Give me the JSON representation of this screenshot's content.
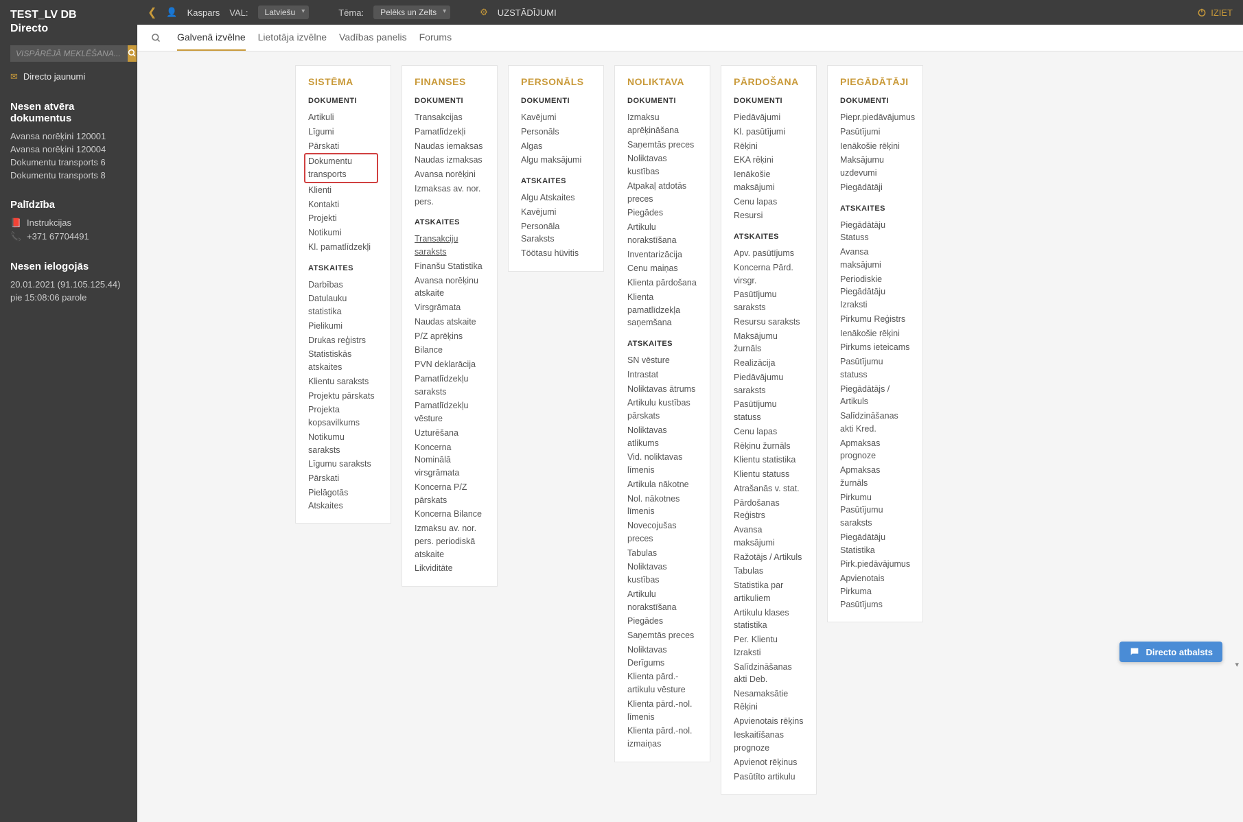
{
  "sidebar": {
    "title1": "TEST_LV DB",
    "title2": "Directo",
    "search_placeholder": "VISPĀRĒJĀ MEKLĒŠANA...",
    "news": "Directo jaunumi",
    "recent_docs_title": "Nesen atvēra dokumentus",
    "recent_docs": [
      "Avansa norēķini 120001",
      "Avansa norēķini 120004",
      "Dokumentu transports 6",
      "Dokumentu transports 8"
    ],
    "help_title": "Palīdzība",
    "help_instructions": "Instrukcijas",
    "help_phone": "+371 67704491",
    "login_title": "Nesen ielogojās",
    "login_line1": "20.01.2021 (91.105.125.44)",
    "login_line2": "pie 15:08:06 parole"
  },
  "topbar": {
    "user": "Kaspars",
    "lang_label": "VAL:",
    "lang_value": "Latviešu",
    "theme_label": "Tēma:",
    "theme_value": "Pelēks un Zelts",
    "settings": "UZSTĀDĪJUMI",
    "logout": "IZIET"
  },
  "tabs": [
    "Galvenā izvēlne",
    "Lietotāja izvēlne",
    "Vadības panelis",
    "Forums"
  ],
  "columns": [
    {
      "title": "SISTĒMA",
      "sections": [
        {
          "label": "DOKUMENTI",
          "items": [
            {
              "t": "Artikuli"
            },
            {
              "t": "Līgumi"
            },
            {
              "t": "Pārskati"
            },
            {
              "t": "Dokumentu transports",
              "hl": true
            },
            {
              "t": "Klienti"
            },
            {
              "t": "Kontakti"
            },
            {
              "t": "Projekti"
            },
            {
              "t": "Notikumi"
            },
            {
              "t": "Kl. pamatlīdzekļi"
            }
          ]
        },
        {
          "label": "ATSKAITES",
          "items": [
            {
              "t": "Darbības"
            },
            {
              "t": "Datulauku statistika"
            },
            {
              "t": "Pielikumi"
            },
            {
              "t": "Drukas reģistrs"
            },
            {
              "t": "Statistiskās atskaites"
            },
            {
              "t": "Klientu saraksts"
            },
            {
              "t": "Projektu pārskats"
            },
            {
              "t": "Projekta kopsavilkums"
            },
            {
              "t": "Notikumu saraksts"
            },
            {
              "t": "Līgumu saraksts"
            },
            {
              "t": "Pārskati"
            },
            {
              "t": "Pielāgotās Atskaites"
            }
          ]
        }
      ]
    },
    {
      "title": "FINANSES",
      "sections": [
        {
          "label": "DOKUMENTI",
          "items": [
            {
              "t": "Transakcijas"
            },
            {
              "t": "Pamatlīdzekļi"
            },
            {
              "t": "Naudas iemaksas"
            },
            {
              "t": "Naudas izmaksas"
            },
            {
              "t": "Avansa norēķini"
            },
            {
              "t": "Izmaksas av. nor. pers."
            }
          ]
        },
        {
          "label": "ATSKAITES",
          "items": [
            {
              "t": "Transakciju saraksts",
              "und": true
            },
            {
              "t": "Finanšu Statistika"
            },
            {
              "t": "Avansa norēķinu atskaite"
            },
            {
              "t": "Virsgrāmata"
            },
            {
              "t": "Naudas atskaite"
            },
            {
              "t": "P/Z aprēķins"
            },
            {
              "t": "Bilance"
            },
            {
              "t": "PVN deklarācija"
            },
            {
              "t": "Pamatlīdzekļu saraksts"
            },
            {
              "t": "Pamatlīdzekļu vēsture"
            },
            {
              "t": "Uzturēšana"
            },
            {
              "t": "Koncerna Nominālā virsgrāmata"
            },
            {
              "t": "Koncerna P/Z pārskats"
            },
            {
              "t": "Koncerna Bilance"
            },
            {
              "t": "Izmaksu av. nor. pers. periodiskā atskaite"
            },
            {
              "t": "Likviditāte"
            }
          ]
        }
      ]
    },
    {
      "title": "PERSONĀLS",
      "sections": [
        {
          "label": "DOKUMENTI",
          "items": [
            {
              "t": "Kavējumi"
            },
            {
              "t": "Personāls"
            },
            {
              "t": "Algas"
            },
            {
              "t": "Algu maksājumi"
            }
          ]
        },
        {
          "label": "ATSKAITES",
          "items": [
            {
              "t": "Algu Atskaites"
            },
            {
              "t": "Kavējumi"
            },
            {
              "t": "Personāla Saraksts"
            },
            {
              "t": "Töötasu hüvitis"
            }
          ]
        }
      ]
    },
    {
      "title": "NOLIKTAVA",
      "sections": [
        {
          "label": "DOKUMENTI",
          "items": [
            {
              "t": "Izmaksu aprēķināšana"
            },
            {
              "t": "Saņemtās preces"
            },
            {
              "t": "Noliktavas kustības"
            },
            {
              "t": "Atpakaļ atdotās preces"
            },
            {
              "t": "Piegādes"
            },
            {
              "t": "Artikulu norakstīšana"
            },
            {
              "t": "Inventarizācija"
            },
            {
              "t": "Cenu maiņas"
            },
            {
              "t": "Klienta pārdošana"
            },
            {
              "t": "Klienta pamatlīdzekļa saņemšana"
            }
          ]
        },
        {
          "label": "ATSKAITES",
          "items": [
            {
              "t": "SN vēsture"
            },
            {
              "t": "Intrastat"
            },
            {
              "t": "Noliktavas ātrums"
            },
            {
              "t": "Artikulu kustības pārskats"
            },
            {
              "t": "Noliktavas atlikums"
            },
            {
              "t": "Vid. noliktavas līmenis"
            },
            {
              "t": "Artikula nākotne"
            },
            {
              "t": "Nol. nākotnes līmenis"
            },
            {
              "t": "Novecojušas preces"
            },
            {
              "t": "Tabulas"
            },
            {
              "t": "Noliktavas kustības"
            },
            {
              "t": "Artikulu norakstīšana"
            },
            {
              "t": "Piegādes"
            },
            {
              "t": "Saņemtās preces"
            },
            {
              "t": "Noliktavas Derīgums"
            },
            {
              "t": "Klienta pārd.-artikulu vēsture"
            },
            {
              "t": "Klienta pārd.-nol. līmenis"
            },
            {
              "t": "Klienta pārd.-nol. izmaiņas"
            }
          ]
        }
      ]
    },
    {
      "title": "PĀRDOŠANA",
      "sections": [
        {
          "label": "DOKUMENTI",
          "items": [
            {
              "t": "Piedāvājumi"
            },
            {
              "t": "Kl. pasūtījumi"
            },
            {
              "t": "Rēķini"
            },
            {
              "t": "EKA rēķini"
            },
            {
              "t": "Ienākošie maksājumi"
            },
            {
              "t": "Cenu lapas"
            },
            {
              "t": "Resursi"
            }
          ]
        },
        {
          "label": "ATSKAITES",
          "items": [
            {
              "t": "Apv. pasūtījums"
            },
            {
              "t": "Koncerna Pārd. virsgr."
            },
            {
              "t": "Pasūtījumu saraksts"
            },
            {
              "t": "Resursu saraksts"
            },
            {
              "t": "Maksājumu žurnāls"
            },
            {
              "t": "Realizācija"
            },
            {
              "t": "Piedāvājumu saraksts"
            },
            {
              "t": "Pasūtījumu statuss"
            },
            {
              "t": "Cenu lapas"
            },
            {
              "t": "Rēķinu žurnāls"
            },
            {
              "t": "Klientu statistika"
            },
            {
              "t": "Klientu statuss"
            },
            {
              "t": "Atrašanās v. stat."
            },
            {
              "t": "Pārdošanas Reģistrs"
            },
            {
              "t": "Avansa maksājumi"
            },
            {
              "t": "Ražotājs / Artikuls"
            },
            {
              "t": "Tabulas"
            },
            {
              "t": "Statistika par artikuliem"
            },
            {
              "t": "Artikulu klases statistika"
            },
            {
              "t": "Per. Klientu Izraksti"
            },
            {
              "t": "Salīdzināšanas akti Deb."
            },
            {
              "t": "Nesamaksātie Rēķini"
            },
            {
              "t": "Apvienotais rēķins"
            },
            {
              "t": "Ieskaitīšanas prognoze"
            },
            {
              "t": "Apvienot rēķinus"
            },
            {
              "t": "Pasūtīto artikulu"
            }
          ]
        }
      ]
    },
    {
      "title": "PIEGĀDĀTĀJI",
      "sections": [
        {
          "label": "DOKUMENTI",
          "items": [
            {
              "t": "Piepr.piedāvājumus"
            },
            {
              "t": "Pasūtījumi"
            },
            {
              "t": "Ienākošie rēķini"
            },
            {
              "t": "Maksājumu uzdevumi"
            },
            {
              "t": "Piegādātāji"
            }
          ]
        },
        {
          "label": "ATSKAITES",
          "items": [
            {
              "t": "Piegādātāju Statuss"
            },
            {
              "t": "Avansa maksājumi"
            },
            {
              "t": "Periodiskie Piegādātāju Izraksti"
            },
            {
              "t": "Pirkumu Reģistrs"
            },
            {
              "t": "Ienākošie rēķini"
            },
            {
              "t": "Pirkums ieteicams"
            },
            {
              "t": "Pasūtījumu statuss"
            },
            {
              "t": "Piegādātājs / Artikuls"
            },
            {
              "t": "Salīdzināšanas akti Kred."
            },
            {
              "t": "Apmaksas prognoze"
            },
            {
              "t": "Apmaksas žurnāls"
            },
            {
              "t": "Pirkumu Pasūtījumu saraksts"
            },
            {
              "t": "Piegādātāju Statistika"
            },
            {
              "t": "Pirk.piedāvājumus"
            },
            {
              "t": "Apvienotais Pirkuma Pasūtījums"
            }
          ]
        }
      ]
    }
  ],
  "support": "Directo atbalsts"
}
